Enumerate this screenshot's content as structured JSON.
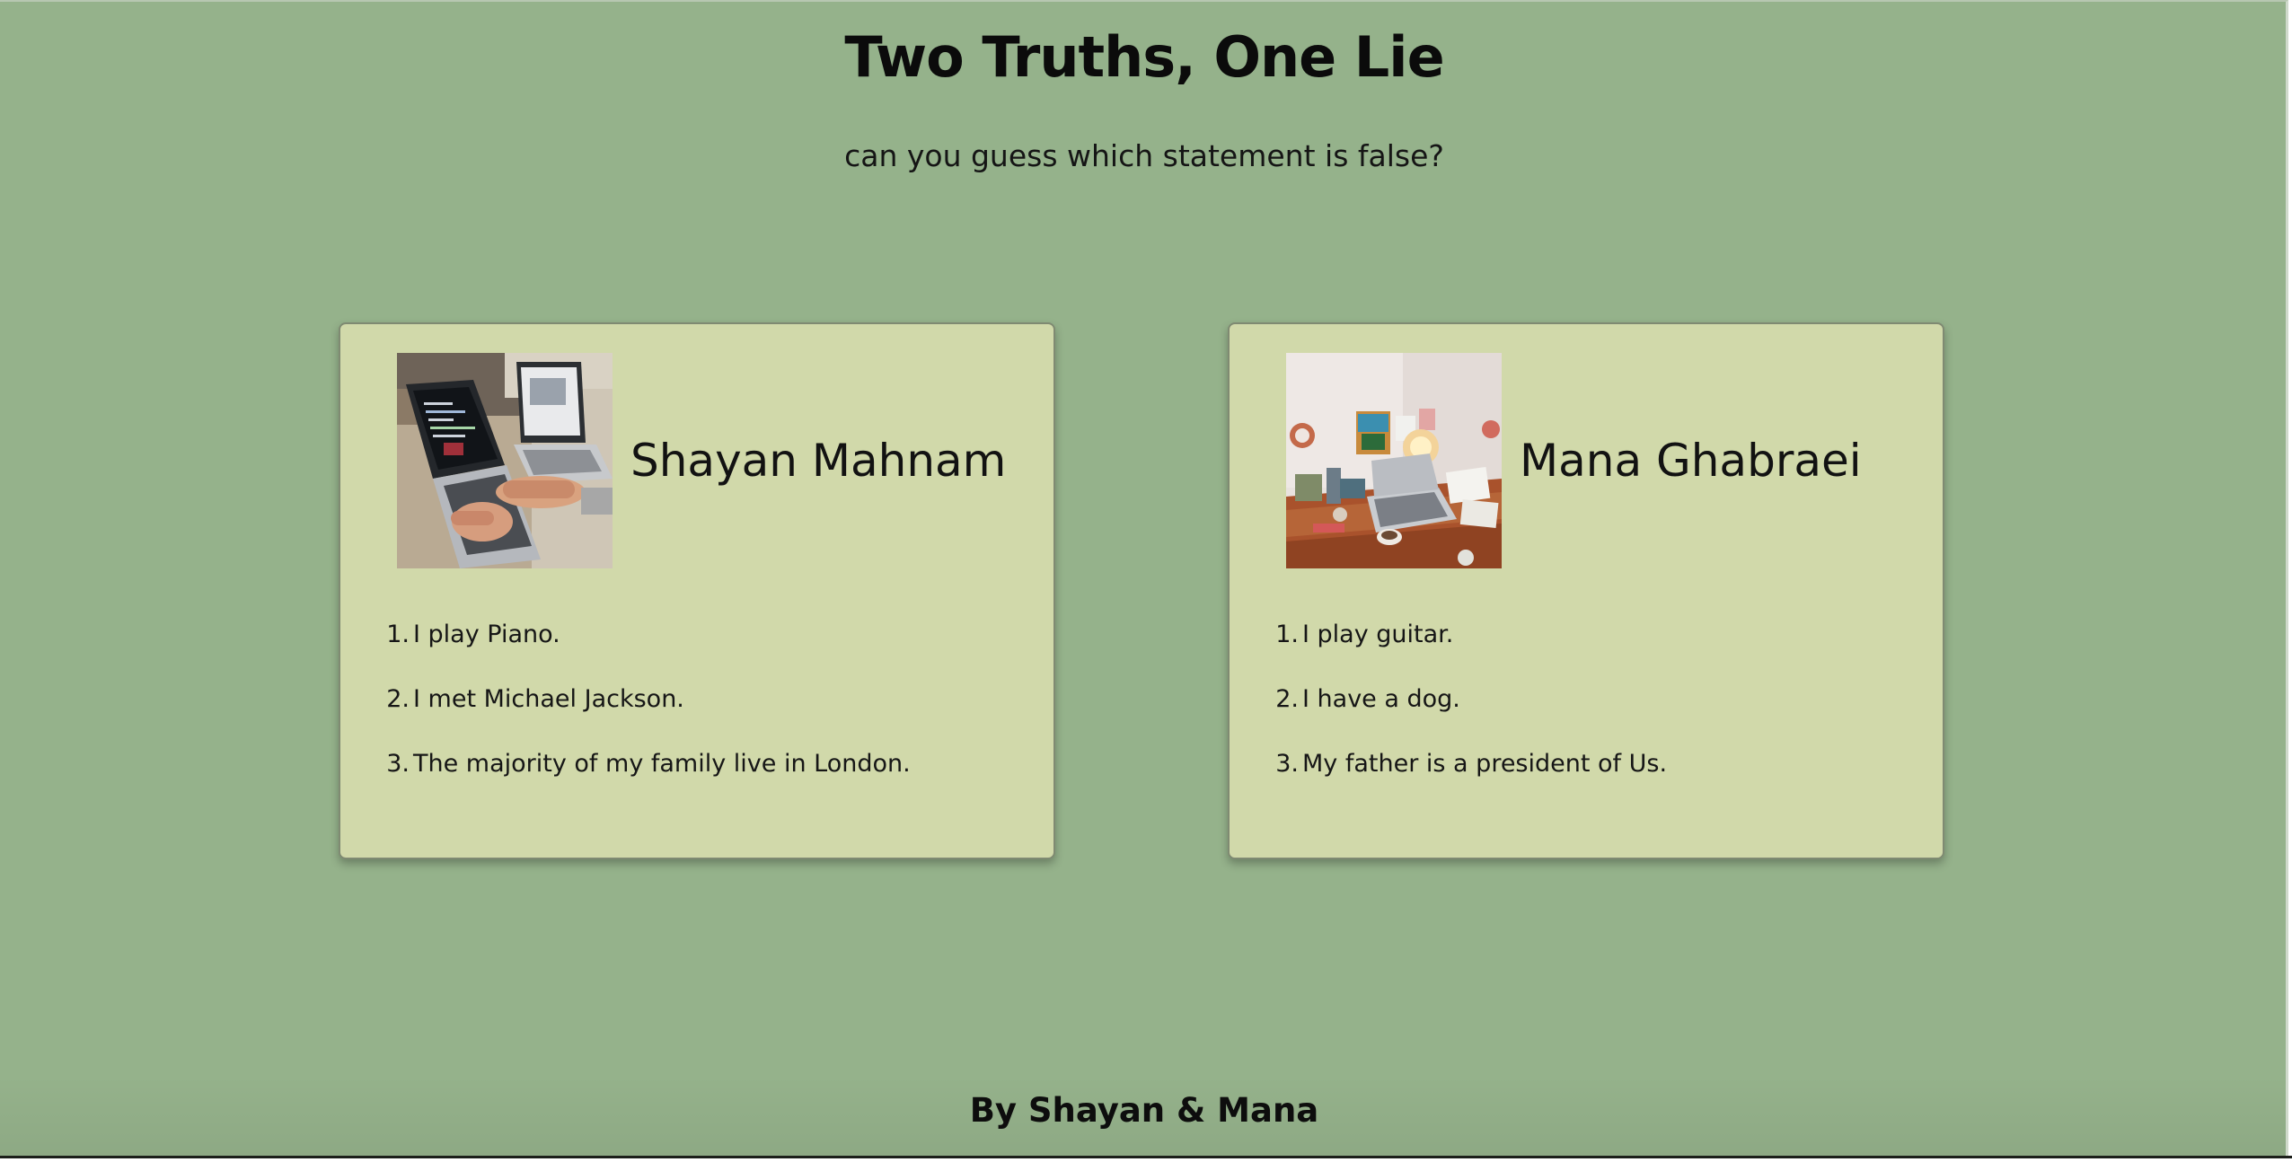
{
  "header": {
    "title": "Two Truths, One Lie",
    "subtitle": "can you guess which statement is false?"
  },
  "cards": [
    {
      "name": "Shayan Mahnam",
      "photo_icon": "laptop-coding-photo",
      "statements": [
        {
          "num": "1.",
          "text": "I play Piano."
        },
        {
          "num": "2.",
          "text": "I met Michael Jackson."
        },
        {
          "num": "3.",
          "text": "The majority of my family live in London."
        }
      ]
    },
    {
      "name": "Mana Ghabraei",
      "photo_icon": "messy-desk-photo",
      "statements": [
        {
          "num": "1.",
          "text": "I play guitar."
        },
        {
          "num": "2.",
          "text": "I have a dog."
        },
        {
          "num": "3.",
          "text": "My father is a president of Us."
        }
      ]
    }
  ],
  "footer": {
    "credit": "By Shayan & Mana"
  },
  "colors": {
    "page_background": "#95b28b",
    "card_background": "#d1d9aa",
    "text": "#111111"
  }
}
